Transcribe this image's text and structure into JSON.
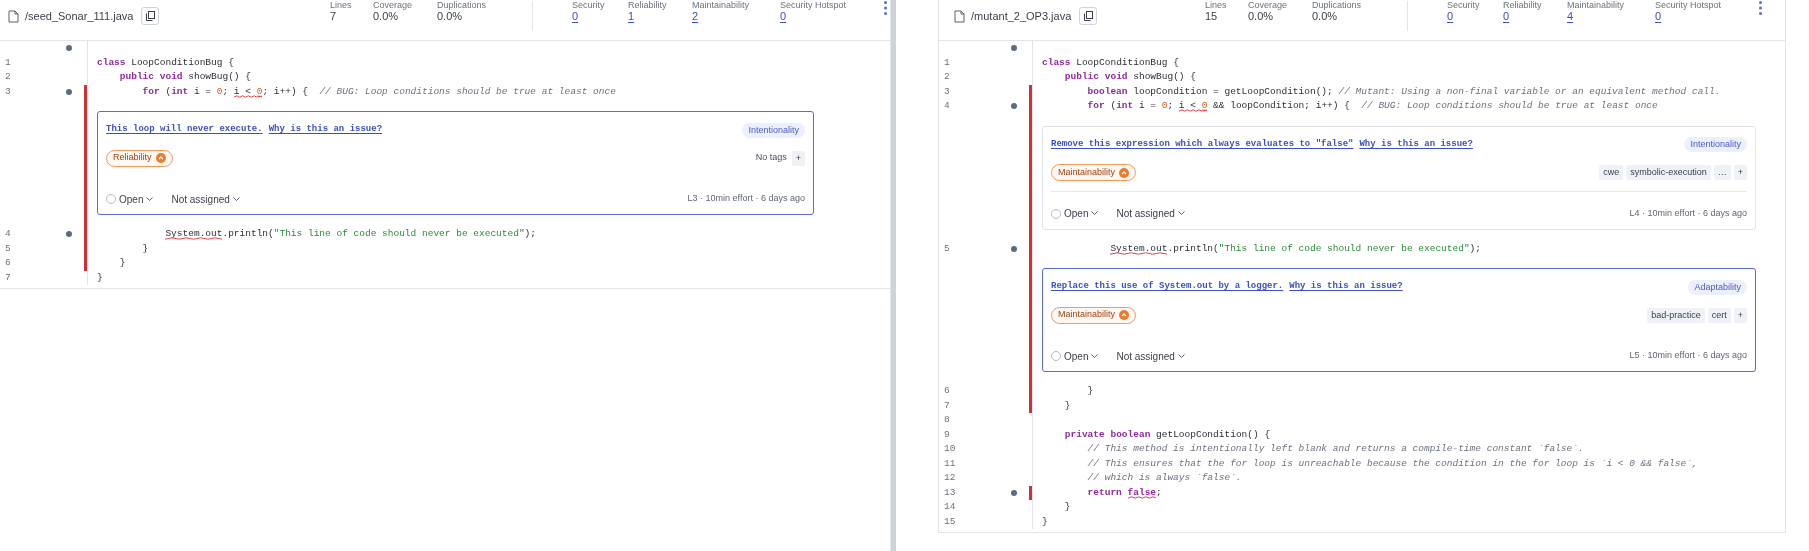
{
  "panels": [
    {
      "file": {
        "name": "/seed_Sonar_111.java"
      },
      "metrics": [
        {
          "label": "Lines",
          "value": "7",
          "link": false
        },
        {
          "label": "Coverage",
          "value": "0.0%",
          "link": false
        },
        {
          "label": "Duplications",
          "value": "0.0%",
          "link": false
        },
        {
          "label": "Security",
          "value": "0",
          "link": true
        },
        {
          "label": "Reliability",
          "value": "1",
          "link": true
        },
        {
          "label": "Maintainability",
          "value": "2",
          "link": true
        },
        {
          "label": "Security Hotspot",
          "value": "0",
          "link": true
        }
      ],
      "rows": [
        {
          "kind": "line",
          "number": "1",
          "dot": false,
          "bar": false,
          "tokens": [
            {
              "text": "class",
              "kind": "keyword",
              "squiggle": false
            },
            {
              "text": " LoopConditionBug {",
              "kind": "plain",
              "squiggle": false
            }
          ]
        },
        {
          "kind": "line",
          "number": "2",
          "dot": false,
          "bar": false,
          "tokens": [
            {
              "text": "    public",
              "kind": "keyword",
              "squiggle": false
            },
            {
              "text": " void",
              "kind": "keyword",
              "squiggle": false
            },
            {
              "text": " showBug() {",
              "kind": "plain",
              "squiggle": false
            }
          ]
        },
        {
          "kind": "line",
          "number": "3",
          "dot": true,
          "bar": true,
          "tokens": [
            {
              "text": "        for",
              "kind": "keyword",
              "squiggle": false
            },
            {
              "text": " (",
              "kind": "plain",
              "squiggle": false
            },
            {
              "text": "int",
              "kind": "keyword",
              "squiggle": false
            },
            {
              "text": " i = ",
              "kind": "plain",
              "squiggle": false
            },
            {
              "text": "0",
              "kind": "number",
              "squiggle": false
            },
            {
              "text": "; ",
              "kind": "plain",
              "squiggle": false
            },
            {
              "text": "i < ",
              "kind": "plain",
              "squiggle": true
            },
            {
              "text": "0",
              "kind": "number",
              "squiggle": true
            },
            {
              "text": "; i++) {  ",
              "kind": "plain",
              "squiggle": false
            },
            {
              "text": "// BUG: Loop conditions should be true at least once",
              "kind": "comment",
              "squiggle": false
            }
          ]
        },
        {
          "kind": "issue",
          "bar": true,
          "selected": true,
          "message": "This loop will never execute.",
          "why_link": "Why is this an issue?",
          "attribute": "Intentionality",
          "quality": "Reliability",
          "tags_label": "No tags",
          "add_tag": "+",
          "status": "Open",
          "assignee": "Not assigned",
          "meta": "L3 · 10min effort · 6 days ago"
        },
        {
          "kind": "line",
          "number": "4",
          "dot": true,
          "bar": true,
          "tokens": [
            {
              "text": "            System.out",
              "kind": "plain",
              "squiggle": true
            },
            {
              "text": ".println(",
              "kind": "plain",
              "squiggle": false
            },
            {
              "text": "\"This line of code should never be executed\"",
              "kind": "string",
              "squiggle": false
            },
            {
              "text": ");",
              "kind": "plain",
              "squiggle": false
            }
          ]
        },
        {
          "kind": "line",
          "number": "5",
          "dot": false,
          "bar": true,
          "tokens": [
            {
              "text": "        }",
              "kind": "plain",
              "squiggle": false
            }
          ]
        },
        {
          "kind": "line",
          "number": "6",
          "dot": false,
          "bar": true,
          "tokens": [
            {
              "text": "    }",
              "kind": "plain",
              "squiggle": false
            }
          ]
        },
        {
          "kind": "line",
          "number": "7",
          "dot": false,
          "bar": false,
          "tokens": [
            {
              "text": "}",
              "kind": "plain",
              "squiggle": false
            }
          ]
        }
      ]
    },
    {
      "file": {
        "name": "/mutant_2_OP3.java"
      },
      "metrics": [
        {
          "label": "Lines",
          "value": "15",
          "link": false
        },
        {
          "label": "Coverage",
          "value": "0.0%",
          "link": false
        },
        {
          "label": "Duplications",
          "value": "0.0%",
          "link": false
        },
        {
          "label": "Security",
          "value": "0",
          "link": true
        },
        {
          "label": "Reliability",
          "value": "0",
          "link": true
        },
        {
          "label": "Maintainability",
          "value": "4",
          "link": true
        },
        {
          "label": "Security Hotspot",
          "value": "0",
          "link": true
        }
      ],
      "rows": [
        {
          "kind": "line",
          "number": "1",
          "dot": false,
          "bar": false,
          "tokens": [
            {
              "text": "class",
              "kind": "keyword",
              "squiggle": false
            },
            {
              "text": " LoopConditionBug {",
              "kind": "plain",
              "squiggle": false
            }
          ]
        },
        {
          "kind": "line",
          "number": "2",
          "dot": false,
          "bar": false,
          "tokens": [
            {
              "text": "    public",
              "kind": "keyword",
              "squiggle": false
            },
            {
              "text": " void",
              "kind": "keyword",
              "squiggle": false
            },
            {
              "text": " showBug() {",
              "kind": "plain",
              "squiggle": false
            }
          ]
        },
        {
          "kind": "line",
          "number": "3",
          "dot": false,
          "bar": true,
          "tokens": [
            {
              "text": "        boolean",
              "kind": "keyword",
              "squiggle": false
            },
            {
              "text": " loopCondition = getLoopCondition(); ",
              "kind": "plain",
              "squiggle": false
            },
            {
              "text": "// Mutant: Using a non-final variable or an equivalent method call.",
              "kind": "comment",
              "squiggle": false
            }
          ]
        },
        {
          "kind": "line",
          "number": "4",
          "dot": true,
          "bar": true,
          "tokens": [
            {
              "text": "        for",
              "kind": "keyword",
              "squiggle": false
            },
            {
              "text": " (",
              "kind": "plain",
              "squiggle": false
            },
            {
              "text": "int",
              "kind": "keyword",
              "squiggle": false
            },
            {
              "text": " i = ",
              "kind": "plain",
              "squiggle": false
            },
            {
              "text": "0",
              "kind": "number",
              "squiggle": false
            },
            {
              "text": "; ",
              "kind": "plain",
              "squiggle": false
            },
            {
              "text": "i < ",
              "kind": "plain",
              "squiggle": true
            },
            {
              "text": "0",
              "kind": "number",
              "squiggle": true
            },
            {
              "text": " && loopCondition; i++) {  ",
              "kind": "plain",
              "squiggle": false
            },
            {
              "text": "// BUG: Loop conditions should be true at least once",
              "kind": "comment",
              "squiggle": false
            }
          ]
        },
        {
          "kind": "issue",
          "bar": true,
          "selected": false,
          "message": "Remove this expression which always evaluates to \"false\"",
          "why_link": "Why is this an issue?",
          "attribute": "Intentionality",
          "quality": "Maintainability",
          "tags": [
            "cwe",
            "symbolic-execution",
            "…"
          ],
          "add_tag": "+",
          "status": "Open",
          "assignee": "Not assigned",
          "meta": "L4 · 10min effort · 6 days ago"
        },
        {
          "kind": "line",
          "number": "5",
          "dot": true,
          "bar": true,
          "tokens": [
            {
              "text": "            System.out",
              "kind": "plain",
              "squiggle": true
            },
            {
              "text": ".println(",
              "kind": "plain",
              "squiggle": false
            },
            {
              "text": "\"This line of code should never be executed\"",
              "kind": "string",
              "squiggle": false
            },
            {
              "text": ");",
              "kind": "plain",
              "squiggle": false
            }
          ]
        },
        {
          "kind": "issue",
          "bar": true,
          "selected": true,
          "message": "Replace this use of System.out by a logger.",
          "why_link": "Why is this an issue?",
          "attribute": "Adaptability",
          "quality": "Maintainability",
          "tags": [
            "bad-practice",
            "cert"
          ],
          "add_tag": "+",
          "status": "Open",
          "assignee": "Not assigned",
          "meta": "L5 · 10min effort · 6 days ago"
        },
        {
          "kind": "line",
          "number": "6",
          "dot": false,
          "bar": true,
          "tokens": [
            {
              "text": "        }",
              "kind": "plain",
              "squiggle": false
            }
          ]
        },
        {
          "kind": "line",
          "number": "7",
          "dot": false,
          "bar": true,
          "tokens": [
            {
              "text": "    }",
              "kind": "plain",
              "squiggle": false
            }
          ]
        },
        {
          "kind": "line",
          "number": "8",
          "dot": false,
          "bar": false
        },
        {
          "kind": "line",
          "number": "9",
          "dot": false,
          "bar": false,
          "tokens": [
            {
              "text": "    private",
              "kind": "keyword",
              "squiggle": false
            },
            {
              "text": " boolean",
              "kind": "keyword",
              "squiggle": false
            },
            {
              "text": " getLoopCondition() {",
              "kind": "plain",
              "squiggle": false
            }
          ]
        },
        {
          "kind": "line",
          "number": "10",
          "dot": false,
          "bar": false,
          "tokens": [
            {
              "text": "        // This method is intentionally left blank and returns a compile-time constant `false`.",
              "kind": "comment",
              "squiggle": false
            }
          ]
        },
        {
          "kind": "line",
          "number": "11",
          "dot": false,
          "bar": false,
          "tokens": [
            {
              "text": "        // This ensures that the for loop is unreachable because the condition in the for loop is `i < 0 && false`,",
              "kind": "comment",
              "squiggle": false
            }
          ]
        },
        {
          "kind": "line",
          "number": "12",
          "dot": false,
          "bar": false,
          "tokens": [
            {
              "text": "        // which is always `false`.",
              "kind": "comment",
              "squiggle": false
            }
          ]
        },
        {
          "kind": "line",
          "number": "13",
          "dot": true,
          "bar": true,
          "tokens": [
            {
              "text": "        return",
              "kind": "keyword",
              "squiggle": false
            },
            {
              "text": " false",
              "kind": "keyword",
              "squiggle": true
            },
            {
              "text": ";",
              "kind": "plain",
              "squiggle": false
            }
          ]
        },
        {
          "kind": "line",
          "number": "14",
          "dot": false,
          "bar": false,
          "tokens": [
            {
              "text": "    }",
              "kind": "plain",
              "squiggle": false
            }
          ]
        },
        {
          "kind": "line",
          "number": "15",
          "dot": false,
          "bar": false,
          "tokens": [
            {
              "text": "}",
              "kind": "plain",
              "squiggle": false
            }
          ]
        }
      ]
    }
  ]
}
